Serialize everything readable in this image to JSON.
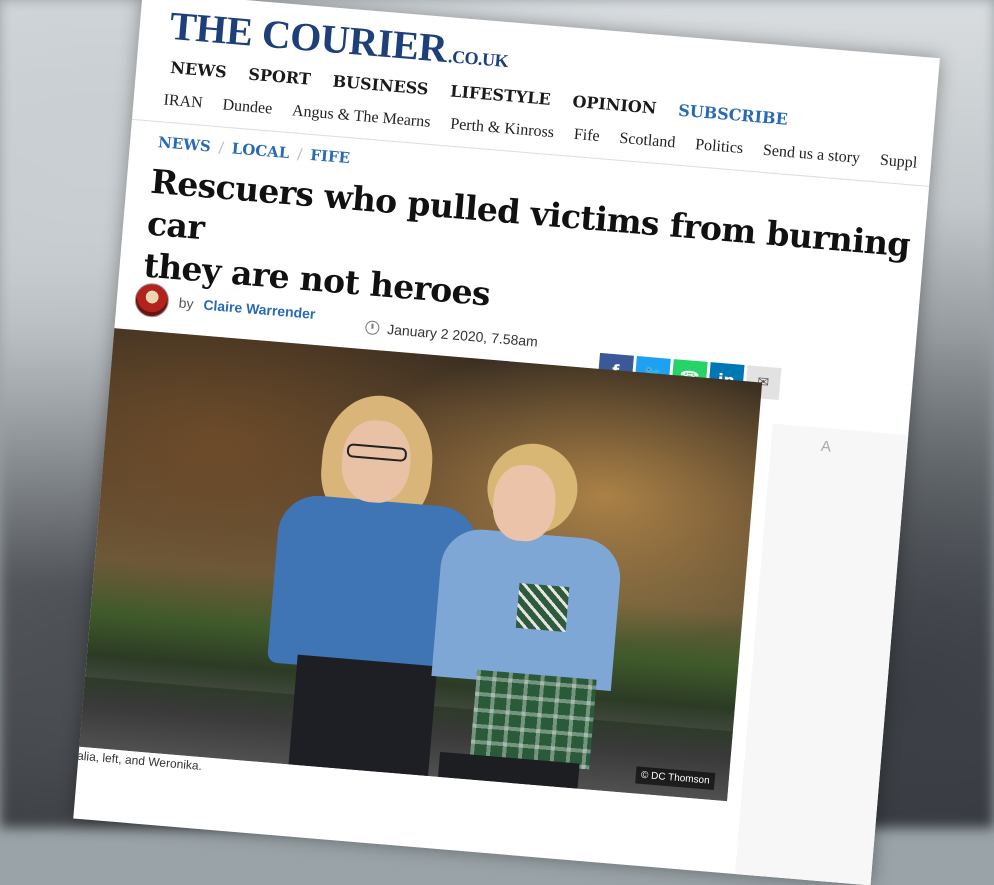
{
  "site": {
    "logo_main": "THE COURIER",
    "logo_domain": ".CO.UK"
  },
  "nav_main": [
    "NEWS",
    "SPORT",
    "BUSINESS",
    "LIFESTYLE",
    "OPINION",
    "SUBSCRIBE"
  ],
  "nav_secondary": [
    "IRAN",
    "Dundee",
    "Angus & The Mearns",
    "Perth & Kinross",
    "Fife",
    "Scotland",
    "Politics",
    "Send us a story",
    "Suppl"
  ],
  "breadcrumb": [
    "NEWS",
    "LOCAL",
    "FIFE"
  ],
  "breadcrumb_separator": "/",
  "article": {
    "headline_line1": "Rescuers who pulled victims from burning car",
    "headline_line2": "they are not heroes",
    "by": "by",
    "author": "Claire Warrender",
    "date": "January 2 2020, 7.58am",
    "caption": "Natalia, left, and Weronika.",
    "photo_credit": "© DC Thomson"
  },
  "share": {
    "facebook": "f",
    "twitter": "🐦",
    "whatsapp": "☎",
    "linkedin": "in",
    "email": "✉"
  },
  "sidebar": {
    "ad_label": "A"
  },
  "colors": {
    "brand": "#1d3f7a",
    "link": "#2a6ab5",
    "facebook": "#3b5998",
    "twitter": "#1da1f2",
    "whatsapp": "#25d366",
    "linkedin": "#0077b5"
  }
}
